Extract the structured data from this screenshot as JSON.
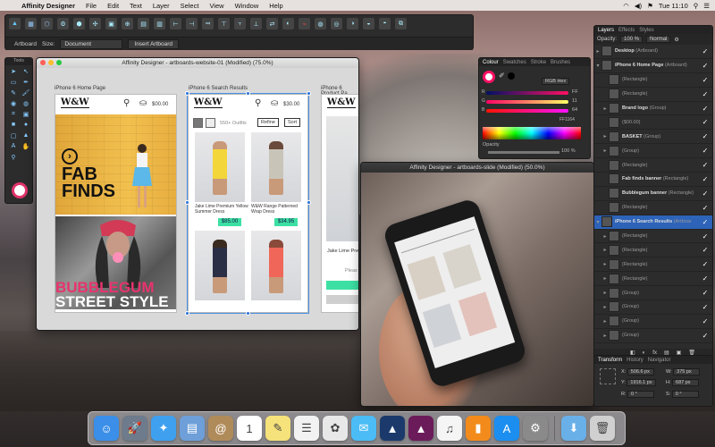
{
  "menubar": {
    "app": "Affinity Designer",
    "items": [
      "File",
      "Edit",
      "Text",
      "Layer",
      "Select",
      "View",
      "Window",
      "Help"
    ],
    "clock": "Tue 11:10"
  },
  "toolbar": {
    "context": {
      "artboard_label": "Artboard",
      "size_label": "Size:",
      "size_value": "Document",
      "insert_label": "Insert Artboard"
    }
  },
  "tools_panel": {
    "title": "Tools"
  },
  "windows": {
    "website": {
      "title": "Affinity Designer - artboards-website-01 (Modified) (75.0%)",
      "artboards": {
        "home": {
          "label": "iPhone 6 Home Page",
          "logo": "W&W",
          "price": "$00.00",
          "hero_text_1": "FAB",
          "hero_text_2": "FINDS",
          "bubble_1": "BUBBLEGUM",
          "bubble_2": "STREET STYLE"
        },
        "search": {
          "label": "iPhone 6 Search Results",
          "logo": "W&W",
          "price": "$30.00",
          "count": "550+ Outfits",
          "refine": "Refine",
          "sort": "Sort",
          "products": [
            {
              "name": "Jake Lime Premium Yellow Summer Dress",
              "price": "$85.00"
            },
            {
              "name": "W&W Range Patterned Wrap Dress",
              "price": "$34.95"
            }
          ]
        },
        "product": {
          "label": "iPhone 6 Product Pa",
          "logo": "W&W",
          "name": "Jake Lime Pre",
          "please": "Pleas"
        }
      }
    },
    "slide": {
      "title": "Affinity Designer - artboards-slide (Modified) (50.0%)"
    }
  },
  "colour_panel": {
    "tabs": [
      "Colour",
      "Swatches",
      "Stroke",
      "Brushes"
    ],
    "mode": "RGB Hex",
    "channels": [
      {
        "name": "R",
        "value": "FF"
      },
      {
        "name": "G",
        "value": "11"
      },
      {
        "name": "B",
        "value": "64"
      }
    ],
    "hex": "FF1164",
    "opacity_label": "Opacity",
    "opacity_value": "100 %"
  },
  "layers_panel": {
    "tabs": [
      "Layers",
      "Effects",
      "Styles"
    ],
    "opacity_label": "Opacity:",
    "opacity_value": "100 %",
    "blend": "Normal",
    "layers": [
      {
        "name": "Desktop",
        "type": "(Artboard)",
        "twisty": "▸",
        "indent": 0,
        "selected": false,
        "bold": true
      },
      {
        "name": "iPhone 6 Home Page",
        "type": "(Artboard)",
        "twisty": "▾",
        "indent": 0,
        "selected": false,
        "bold": true
      },
      {
        "name": "",
        "type": "(Rectangle)",
        "twisty": "",
        "indent": 1,
        "selected": false,
        "bold": false
      },
      {
        "name": "",
        "type": "(Rectangle)",
        "twisty": "",
        "indent": 1,
        "selected": false,
        "bold": false
      },
      {
        "name": "Brand logo",
        "type": "(Group)",
        "twisty": "▸",
        "indent": 1,
        "selected": false,
        "bold": true
      },
      {
        "name": "",
        "type": "($00.00)",
        "twisty": "",
        "indent": 1,
        "selected": false,
        "bold": false
      },
      {
        "name": "BASKET",
        "type": "(Group)",
        "twisty": "▸",
        "indent": 1,
        "selected": false,
        "bold": true
      },
      {
        "name": "",
        "type": "(Group)",
        "twisty": "▸",
        "indent": 1,
        "selected": false,
        "bold": false
      },
      {
        "name": "",
        "type": "(Rectangle)",
        "twisty": "",
        "indent": 1,
        "selected": false,
        "bold": false
      },
      {
        "name": "Fab finds banner",
        "type": "(Rectangle)",
        "twisty": "",
        "indent": 1,
        "selected": false,
        "bold": true
      },
      {
        "name": "Bubblegum banner",
        "type": "(Rectangle)",
        "twisty": "",
        "indent": 1,
        "selected": false,
        "bold": true
      },
      {
        "name": "",
        "type": "(Rectangle)",
        "twisty": "",
        "indent": 1,
        "selected": false,
        "bold": false
      },
      {
        "name": "iPhone 6 Search Results",
        "type": "(Artboar",
        "twisty": "▾",
        "indent": 0,
        "selected": true,
        "bold": true
      },
      {
        "name": "",
        "type": "(Rectangle)",
        "twisty": "▸",
        "indent": 1,
        "selected": false,
        "bold": false
      },
      {
        "name": "",
        "type": "(Rectangle)",
        "twisty": "▸",
        "indent": 1,
        "selected": false,
        "bold": false
      },
      {
        "name": "",
        "type": "(Rectangle)",
        "twisty": "▸",
        "indent": 1,
        "selected": false,
        "bold": false
      },
      {
        "name": "",
        "type": "(Rectangle)",
        "twisty": "▸",
        "indent": 1,
        "selected": false,
        "bold": false
      },
      {
        "name": "",
        "type": "(Group)",
        "twisty": "▸",
        "indent": 1,
        "selected": false,
        "bold": false
      },
      {
        "name": "",
        "type": "(Group)",
        "twisty": "▸",
        "indent": 1,
        "selected": false,
        "bold": false
      },
      {
        "name": "",
        "type": "(Group)",
        "twisty": "▸",
        "indent": 1,
        "selected": false,
        "bold": false
      },
      {
        "name": "",
        "type": "(Group)",
        "twisty": "▸",
        "indent": 1,
        "selected": false,
        "bold": false
      }
    ]
  },
  "transform_panel": {
    "tabs": [
      "Transform",
      "History",
      "Navigator"
    ],
    "x": "506.6 px",
    "y": "1916.1 px",
    "w": "375 px",
    "h": "687 px",
    "r": "0 °",
    "s": "0 °"
  },
  "dock": {
    "items": [
      {
        "name": "finder",
        "glyph": "☺",
        "color": "#3b8fe8"
      },
      {
        "name": "launchpad",
        "glyph": "🚀",
        "color": "#6d7b8c"
      },
      {
        "name": "safari",
        "glyph": "✦",
        "color": "#3fa0f0"
      },
      {
        "name": "preview",
        "glyph": "▤",
        "color": "#6e9fd8"
      },
      {
        "name": "contacts",
        "glyph": "@",
        "color": "#b08b5a"
      },
      {
        "name": "calendar",
        "glyph": "1",
        "color": "#ffffff"
      },
      {
        "name": "notes",
        "glyph": "✎",
        "color": "#f5e27a"
      },
      {
        "name": "reminders",
        "glyph": "☰",
        "color": "#f2f2f2"
      },
      {
        "name": "photos",
        "glyph": "✿",
        "color": "#e8e8e8"
      },
      {
        "name": "messages",
        "glyph": "✉",
        "color": "#4bbcf5"
      },
      {
        "name": "affinity-designer",
        "glyph": "▲",
        "color": "#1b3a6b"
      },
      {
        "name": "affinity-photo",
        "glyph": "▲",
        "color": "#6b1b5a"
      },
      {
        "name": "itunes",
        "glyph": "♫",
        "color": "#f5f5f5"
      },
      {
        "name": "ibooks",
        "glyph": "▮",
        "color": "#f28b1b"
      },
      {
        "name": "app-store",
        "glyph": "A",
        "color": "#1b8ef0"
      },
      {
        "name": "system-preferences",
        "glyph": "⚙",
        "color": "#8a8a8a"
      },
      {
        "name": "downloads-folder",
        "glyph": "⬇",
        "color": "#6ab0e8"
      },
      {
        "name": "trash",
        "glyph": "🗑",
        "color": "#d0d0d0"
      }
    ]
  },
  "colors": {
    "accent": "#ff1164",
    "selection": "#2d63b8",
    "price_tag": "#3de0a3"
  }
}
